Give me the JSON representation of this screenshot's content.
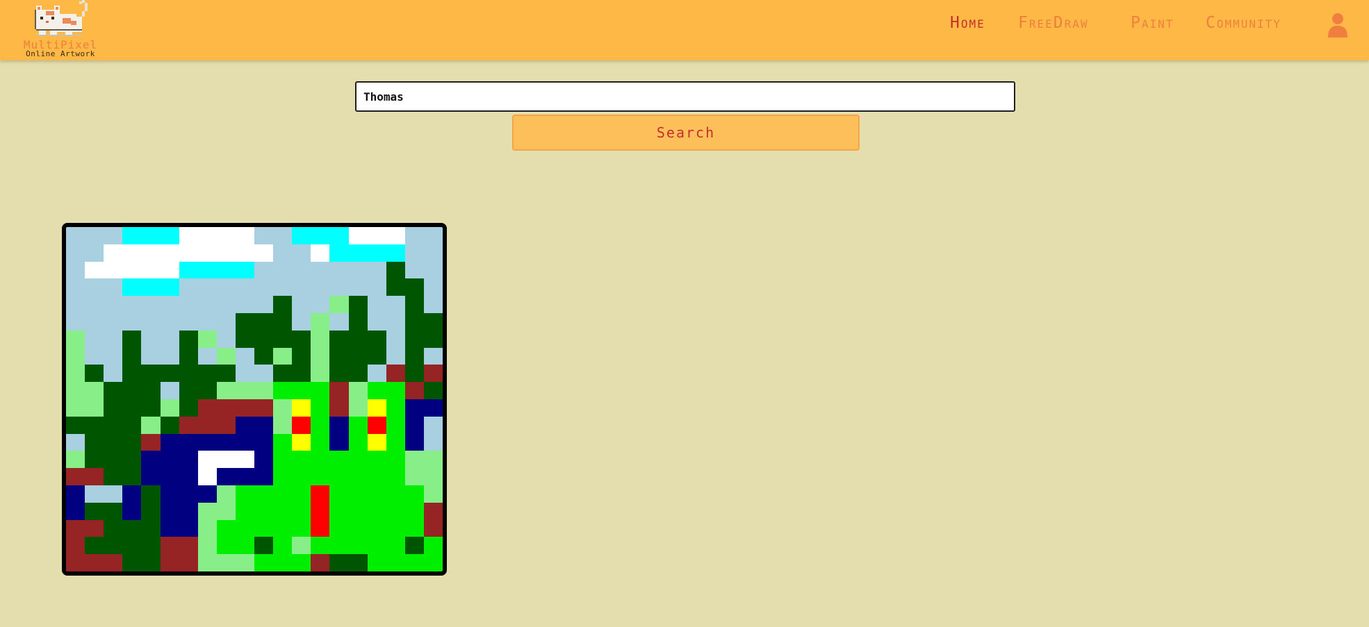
{
  "app": {
    "logo_title": "MultiPixel",
    "logo_subtitle": "Online Artwork"
  },
  "nav": {
    "items": [
      {
        "label": "Home",
        "active": true
      },
      {
        "label": "FreeDraw",
        "active": false
      },
      {
        "label": "Paint",
        "active": false
      },
      {
        "label": "Community",
        "active": false
      }
    ],
    "user_icon": "user-icon"
  },
  "search": {
    "value": "Thomas",
    "button_label": "Search"
  },
  "colors": {
    "header_bg": "#fdb846",
    "page_bg": "#e4ddad",
    "nav_text": "#f07e3e",
    "nav_active": "#c72e2e"
  },
  "artwork": {
    "palette": {
      "S": "#a8d0e0",
      "C": "#00ffff",
      "W": "#ffffff",
      "D": "#005500",
      "L": "#88ee88",
      "G": "#00ee00",
      "R": "#962424",
      "N": "#000080",
      "Y": "#ffff00",
      "F": "#ff0000"
    },
    "rows": [
      "SSSCCCWWWWSSCCCWWWSS",
      "SSWWWWWWWWWSSWCCCCSS",
      "SWWWWWCCCCSSSSSSSDSS",
      "SSSCCCSSSSSSSSSSSDDS",
      "SSSSSSSSSSSDSSLDSSDS",
      "SSSSSSSSSDDDSLSDSSDD",
      "LSSDSSDLSDDDDLDDDSDD",
      "LSSDSSDSLSDLDLDDDSDS",
      "LDSDDDDDDSSDDLDDSRDR",
      "LLDDDSDDLLLGGGRLGGRD",
      "LLDDDLDRRRRLYGRLYGNN",
      "DDDDLDRRRNNLFGNGFGNS",
      "SDDDRNNNNNNGYGNGYGNS",
      "LDDDNNNWWWNGGGGGGGLL",
      "RRDDNNNWNNNGGGGGGGLL",
      "NSSNDNNNLGGGGFGGGGGL",
      "NDDNDNNLLGGGGFGGGGGR",
      "RRDDDNNLGGGGGFGGGGGR",
      "RDDDDRRLGGDGLGGGGGDG",
      "RRRDDRRLLLGGGRDDGGGG"
    ]
  }
}
